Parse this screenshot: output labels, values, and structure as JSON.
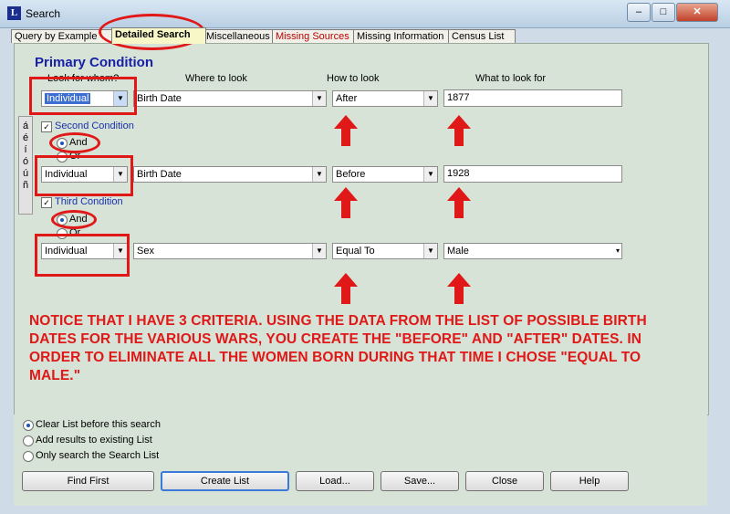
{
  "window": {
    "title": "Search",
    "app_icon": "L"
  },
  "tabs": [
    {
      "label": "Query by Example"
    },
    {
      "label": "Detailed Search"
    },
    {
      "label": "Miscellaneous"
    },
    {
      "label": "Missing Sources"
    },
    {
      "label": "Missing Information"
    },
    {
      "label": "Census List"
    }
  ],
  "heading": "Primary Condition",
  "columns": {
    "look_for_whom": "Look for whom?",
    "where": "Where to look",
    "how": "How to look",
    "what": "What to look for"
  },
  "conditions": [
    {
      "who": "Individual",
      "where": "Birth Date",
      "how": "After",
      "what": "1877"
    },
    {
      "label": "Second Condition",
      "and": "And",
      "or": "Or",
      "who": "Individual",
      "where": "Birth Date",
      "how": "Before",
      "what": "1928"
    },
    {
      "label": "Third Condition",
      "and": "And",
      "or": "Or",
      "who": "Individual",
      "where": "Sex",
      "how": "Equal To",
      "what": "Male"
    }
  ],
  "side_chars": [
    "á",
    "é",
    "í",
    "ó",
    "ú",
    "ñ"
  ],
  "annotation": "NOTICE THAT I HAVE 3 CRITERIA.  USING THE DATA FROM THE LIST OF POSSIBLE BIRTH DATES FOR THE VARIOUS WARS, YOU CREATE THE \"BEFORE\" AND \"AFTER\" DATES.  IN ORDER TO ELIMINATE ALL THE WOMEN BORN DURING THAT TIME I CHOSE \"EQUAL TO MALE.\"",
  "options": [
    {
      "label": "Clear List before this search",
      "selected": true
    },
    {
      "label": "Add results to existing List",
      "selected": false
    },
    {
      "label": "Only search the Search List",
      "selected": false
    }
  ],
  "buttons": {
    "find_first": "Find First",
    "create_list": "Create List",
    "load": "Load...",
    "save": "Save...",
    "close": "Close",
    "help": "Help"
  },
  "colors": {
    "annotation_red": "#e01818",
    "heading_blue": "#1820a8",
    "panel_green": "#d6e3d6"
  }
}
